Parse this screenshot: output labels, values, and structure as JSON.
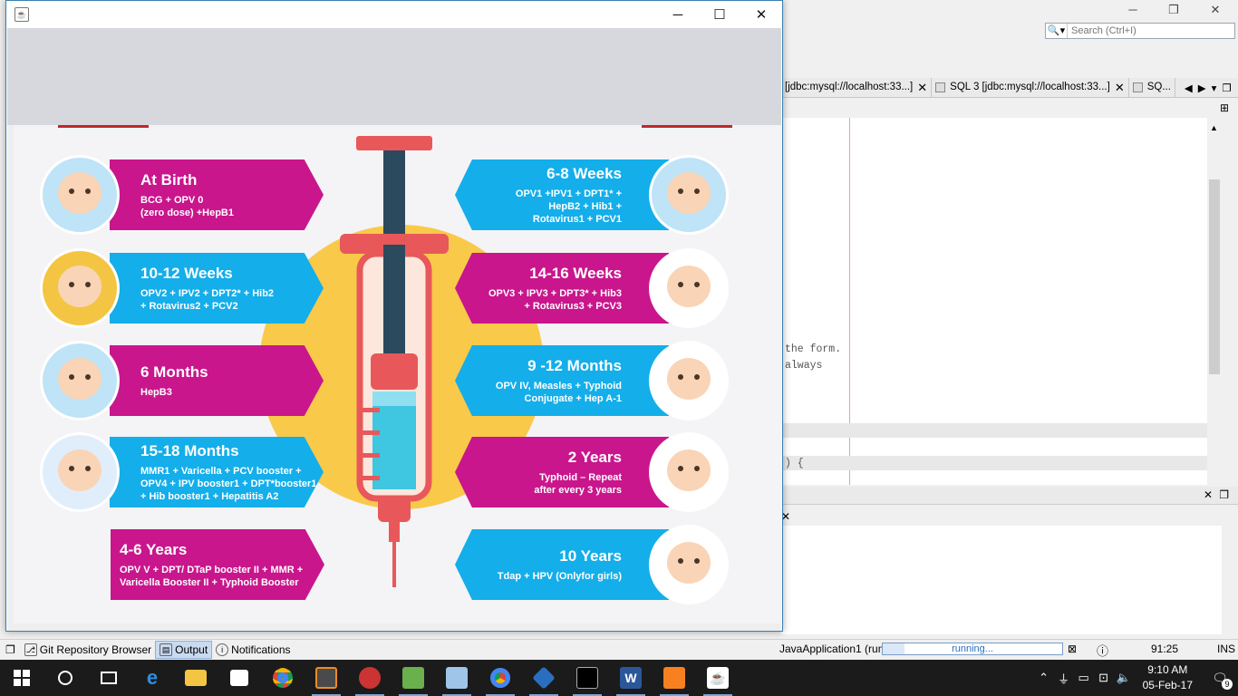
{
  "ide": {
    "window_controls": [
      "─",
      "❐",
      "✕"
    ],
    "search_placeholder": "Search (Ctrl+I)",
    "tabs": [
      {
        "label": "[jdbc:mysql://localhost:33...]",
        "close": "✕"
      },
      {
        "label": "SQL 3 [jdbc:mysql://localhost:33...]",
        "close": "✕"
      },
      {
        "label": "SQ..."
      }
    ],
    "code_lines": [
      "the form.",
      "always",
      ") {"
    ],
    "status": {
      "git": "Git Repository Browser",
      "output": "Output",
      "notifications": "Notifications",
      "run_label": "JavaApplication1 (run)",
      "progress_text": "running...",
      "progress_fraction": 0.12,
      "position": "91:25",
      "mode": "INS"
    }
  },
  "app_window": {
    "controls": [
      "─",
      "☐",
      "✕"
    ]
  },
  "infographic": {
    "colors": {
      "magenta": "#c9168c",
      "cyan": "#14aeea",
      "sun": "#f9c94a"
    },
    "left": [
      {
        "title": "At Birth",
        "desc": "BCG + OPV 0\n(zero dose) +HepB1",
        "color": "magenta"
      },
      {
        "title": "10-12 Weeks",
        "desc": "OPV2 + IPV2 + DPT2* + Hib2\n+ Rotavirus2 + PCV2",
        "color": "cyan"
      },
      {
        "title": "6 Months",
        "desc": "HepB3",
        "color": "magenta"
      },
      {
        "title": "15-18 Months",
        "desc": "MMR1 + Varicella + PCV booster +\nOPV4 + IPV booster1 + DPT*booster1\n+ Hib booster1 + Hepatitis A2",
        "color": "cyan"
      },
      {
        "title": "4-6 Years",
        "desc": "OPV V + DPT/ DTaP booster II + MMR +\nVaricella Booster II + Typhoid Booster",
        "color": "magenta"
      }
    ],
    "right": [
      {
        "title": "6-8 Weeks",
        "desc": "OPV1 +IPV1 + DPT1* +\nHepB2 + Hib1 +\nRotavirus1 + PCV1",
        "color": "cyan"
      },
      {
        "title": "14-16 Weeks",
        "desc": "OPV3 + IPV3 + DPT3* + Hib3\n+ Rotavirus3 + PCV3",
        "color": "magenta"
      },
      {
        "title": "9 -12 Months",
        "desc": "OPV IV, Measles + Typhoid\nConjugate + Hep A-1",
        "color": "cyan"
      },
      {
        "title": "2 Years",
        "desc": "Typhoid – Repeat\nafter every 3 years",
        "color": "magenta"
      },
      {
        "title": "10 Years",
        "desc": "Tdap +  HPV (Onlyfor girls)",
        "color": "cyan"
      }
    ]
  },
  "taskbar": {
    "apps": [
      "start-icon",
      "cortana-icon",
      "task-view-icon",
      "edge-icon",
      "file-explorer-icon",
      "store-icon",
      "chrome-icon",
      "sublime-icon",
      "tool-icon",
      "app-icon",
      "package-icon",
      "chrome-icon",
      "git-icon",
      "terminal-icon",
      "word-icon",
      "xampp-icon",
      "java-icon"
    ],
    "time": "9:10 AM",
    "date": "05-Feb-17",
    "notification_count": "9"
  }
}
